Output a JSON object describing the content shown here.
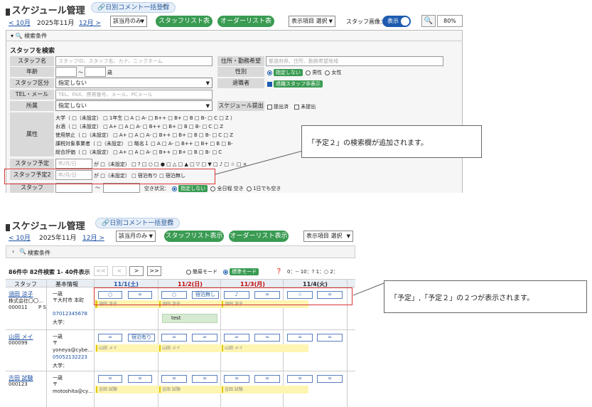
{
  "top": {
    "title": "スケジュール管理",
    "bulk_comment": "日別コメント一括登録",
    "prev_month": "< 10月",
    "current_month": "2025年11月",
    "next_month": "12月 >",
    "month_only": "該当月のみ",
    "staff_list_btn": "スタッフリスト表示",
    "order_list_btn": "オーダーリスト表示",
    "display_items": "表示項目 選択",
    "staff_image_label": "スタッフ画像：",
    "toggle_label": "表示",
    "zoom": "80%",
    "search_conditions": "検索条件",
    "search_staff": "スタッフを検索",
    "labels": {
      "staff_name": "スタッフ名",
      "age": "年齢",
      "staff_type": "スタッフ区分",
      "tel_mail": "TEL・メール",
      "belong": "所属",
      "attr": "属性",
      "yotei": "スタッフ予定",
      "yotei2": "スタッフ予定2",
      "staff_last": "スタッフ",
      "address": "住所・勤務希望",
      "gender": "性別",
      "retired": "退職者",
      "schedule_submit": "スケジュール提出"
    },
    "placeholders": {
      "staff_name": "スタッフID、スタッフ名、カナ、ニックネーム",
      "address": "都道府県、住所、勤務希望地域",
      "tel": "TEL、FAX、携帯番号、メール、PCメール",
      "date": "年/月/日"
    },
    "age_sep": "〜",
    "age_unit": "歳",
    "gender_options": [
      "指定しない",
      "男性",
      "女性"
    ],
    "retired_label": "退職スタッフ非表示",
    "not_specified": "指定しない",
    "submit_options": [
      "提出済",
      "未提出"
    ],
    "attr_rows": [
      "大学（ □（未設定） □ 1年生  □ A  □ A-  □ B++  □ B+  □ B  □ B-  □ C  □ Z ）",
      "お酒（ □（未設定） □ A+  □ A  □ A-  □ B++  □ B+  □ B  □ B-  □ C  □ Z",
      "使用禁止（ □（未設定） □ A+  □ A  □ A-  □ B++  □ B+  □ B  □ B-  □ C  □ Z",
      "課税対象事業者（ □（未設定） □ 略名１  □ A  □ A-  □ B++  □ B+  □ B  □ B-",
      "総合評価（ □（未設定） □ A+  □ A  □ A-  □ B++  □ B+  □ B  □ B-  □ C"
    ],
    "yotei_row": "が □（未設定） □ ?  □ ○  □ ●  □ △  □ ▲  □ ▽  □ ▼  □ ♪  □ ☆  □ ×",
    "yotei2_row": "が □（未設定） □ 宿泊有り  □ 宿泊無し",
    "vacancy_label": "空き状況：",
    "vacancy_options": [
      "指定しない",
      "全日程 空き",
      "1日でも空き"
    ],
    "callout": "「予定２」の検索欄が追加されます。"
  },
  "bottom": {
    "title": "スケジュール管理",
    "bulk_comment": "日別コメント一括登録",
    "prev_month": "< 10月",
    "current_month": "2025年11月",
    "next_month": "12月 >",
    "month_only": "該当月のみ",
    "staff_list_btn": "スタッフリスト表示",
    "order_list_btn": "オーダーリスト表示",
    "display_items": "表示項目 選択",
    "search_conditions": "検索条件",
    "result": "86件中 82件検索 1- 40件表示",
    "pager": [
      "<<",
      "<",
      ">",
      ">>"
    ],
    "modes": [
      "簡易モード",
      "標準モード"
    ],
    "time_info": "0：-- 10：? 1：○ 2：",
    "col_staff": "スタッフ",
    "col_info": "基本情報",
    "dates": [
      "11/1(土)",
      "11/2(日)",
      "11/3(月)",
      "11/4(火)"
    ],
    "date_colors": [
      "#1a4fa3",
      "#c00000",
      "#c00000",
      "#222222"
    ],
    "rows": [
      {
        "name": "須田 涼子",
        "company": "株式会社〇〇…",
        "id": "000011",
        "ps": "P S",
        "info": [
          "一歳",
          "〒大村市 本町",
          "",
          "07012345678",
          "大学："
        ],
        "memo": "須田 涼子"
      },
      {
        "name": "山田 メイ",
        "company": "",
        "id": "000099",
        "ps": "",
        "info": [
          "一歳",
          "〒",
          "yoneya@cybe…",
          "05052132223",
          "大学："
        ],
        "memo": "山田 メイ"
      },
      {
        "name": "吉田 試験",
        "company": "",
        "id": "000123",
        "ps": "",
        "info": [
          "一歳",
          "〒",
          "motoshita@cy…",
          ""
        ],
        "memo": "吉田 試験"
      }
    ],
    "marks_row1": [
      "○",
      "=",
      "○",
      "宿泊無し",
      "♪",
      "=",
      "☆",
      "="
    ],
    "marks_row2": [
      "=",
      "宿泊有り",
      "=",
      "=",
      "=",
      "=",
      "=",
      "="
    ],
    "marks_row3": [
      "=",
      "=",
      "=",
      "=",
      "=",
      "=",
      "=",
      "="
    ],
    "test_label": "test",
    "callout": "「予定」,「予定２」の２つが表示されます。"
  }
}
